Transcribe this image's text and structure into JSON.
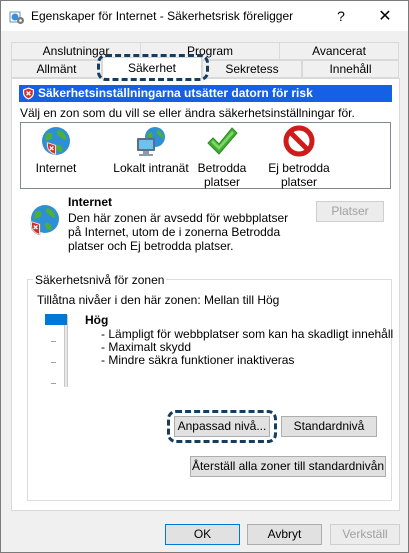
{
  "window": {
    "title": "Egenskaper för Internet - Säkerhetsrisk föreligger",
    "help_label": "?",
    "close_label": "✕"
  },
  "tabs": {
    "row1": [
      "Anslutningar",
      "Program",
      "Avancerat"
    ],
    "row2": [
      "Allmänt",
      "Säkerhet",
      "Sekretess",
      "Innehåll"
    ],
    "active": "Säkerhet"
  },
  "security": {
    "banner": "Säkerhetsinställningarna utsätter datorn för risk",
    "intro": "Välj en zon som du vill se eller ändra säkerhetsinställningar för.",
    "zones": [
      {
        "label": "Internet",
        "icon": "globe-warning-icon"
      },
      {
        "label": "Lokalt intranät",
        "icon": "network-computer-icon"
      },
      {
        "label": "Betrodda platser",
        "icon": "checkmark-icon"
      },
      {
        "label": "Ej betrodda platser",
        "icon": "prohibited-icon"
      }
    ],
    "zone_title": "Internet",
    "zone_description": "Den här zonen är avsedd för webbplatser på Internet, utom de i zonerna Betrodda platser och Ej betrodda platser.",
    "sites_button": "Platser",
    "group_title": "Säkerhetsnivå för zonen",
    "allowed_levels": "Tillåtna nivåer i den här zonen: Mellan till Hög",
    "level_name": "Hög",
    "level_items": [
      "Lämpligt för webbplatser som kan ha skadligt innehåll",
      "Maximalt skydd",
      "Mindre säkra funktioner inaktiveras"
    ],
    "custom_level_button": "Anpassad nivå...",
    "default_level_button": "Standardnivå",
    "reset_all_button": "Återställ alla zoner till standardnivån"
  },
  "footer": {
    "ok": "OK",
    "cancel": "Avbryt",
    "apply": "Verkställ"
  },
  "colors": {
    "banner": "#1660e6",
    "focus_outline": "#163c5e",
    "slider_thumb": "#0078d7"
  }
}
